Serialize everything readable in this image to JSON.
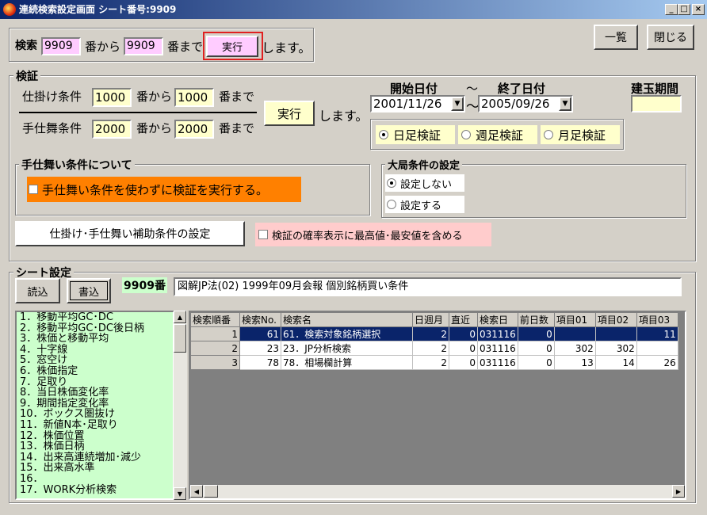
{
  "window": {
    "title": "連続検索設定画面 シート番号:9909"
  },
  "top": {
    "search_label": "検索",
    "from_value": "9909",
    "from_label": "番から",
    "to_value": "9909",
    "to_label": "番まで",
    "run_label": "実行",
    "suffix": "します。",
    "list_button": "一覧",
    "close_button": "閉じる"
  },
  "verify": {
    "legend": "検証",
    "setup_label": "仕掛け条件",
    "setup_from": "1000",
    "setup_from_label": "番から",
    "setup_to": "1000",
    "setup_to_label": "番まで",
    "exit_label": "手仕舞条件",
    "exit_from": "2000",
    "exit_from_label": "番から",
    "exit_to": "2000",
    "exit_to_label": "番まで",
    "run_label": "実行",
    "suffix": "します。",
    "start_date_label": "開始日付",
    "tilde": "〜",
    "end_date_label": "終了日付",
    "start_date": "2001/11/26",
    "end_date": "2005/09/26",
    "position_period_label": "建玉期間",
    "position_period_value": "",
    "radio_daily": "日足検証",
    "radio_weekly": "週足検証",
    "radio_monthly": "月足検証"
  },
  "exit_conditions": {
    "legend": "手仕舞い条件について",
    "checkbox_label": "手仕舞い条件を使わずに検証を実行する。"
  },
  "market": {
    "legend": "大局条件の設定",
    "option_no": "設定しない",
    "option_yes": "設定する"
  },
  "aux_button": "仕掛け･手仕舞い補助条件の設定",
  "prob_checkbox": "検証の確率表示に最高値･最安値を含める",
  "sheet": {
    "legend": "シート設定",
    "read_button": "読込",
    "write_button": "書込",
    "sheet_no": "9909番",
    "sheet_name": "図解JP法(02) 1999年09月会報 個別銘柄買い条件"
  },
  "search_list": [
    "1．移動平均GC･DC",
    "2．移動平均GC･DC後日柄",
    "3．株価と移動平均",
    "4．十字線",
    "5．窓空け",
    "6．株価指定",
    "7．足取り",
    "8．当日株価変化率",
    "9．期間指定変化率",
    "10．ボックス圏抜け",
    "11．新値N本･足取り",
    "12．株価位置",
    "13．株価日柄",
    "14．出来高連続増加･減少",
    "15．出来高水準",
    "16．",
    "17．WORK分析検索"
  ],
  "grid": {
    "headers": [
      "検索順番",
      "検索No.",
      "検索名",
      "日週月",
      "直近",
      "検索日",
      "前日数",
      "項目01",
      "項目02",
      "項目03"
    ],
    "rows": [
      [
        "1",
        "61",
        "61．検索対象銘柄選択",
        "2",
        "0",
        "031116",
        "0",
        "",
        "",
        "11"
      ],
      [
        "2",
        "23",
        "23．JP分析検索",
        "2",
        "0",
        "031116",
        "0",
        "302",
        "302",
        ""
      ],
      [
        "3",
        "78",
        "78．相場欄計算",
        "2",
        "0",
        "031116",
        "0",
        "13",
        "14",
        "26"
      ]
    ]
  },
  "colors": {
    "title_start": "#0a246a",
    "title_end": "#a6caf0",
    "pink_input": "#ffccff",
    "yellow_input": "#ffffcc",
    "orange_check": "#ff8000",
    "list_green": "#ccffcc",
    "selection": "#0a246a"
  },
  "icons": {
    "window": "flame-icon",
    "minimize": "minimize-icon",
    "maximize": "maximize-icon",
    "close": "close-icon"
  }
}
